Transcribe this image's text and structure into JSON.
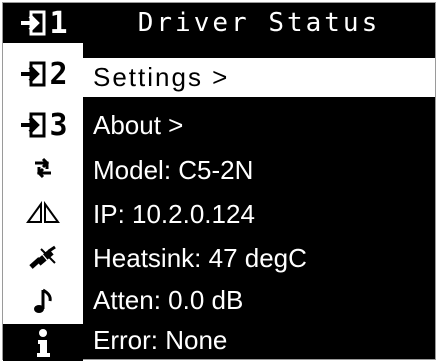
{
  "screen": {
    "title": "Driver Status"
  },
  "sidebar": {
    "items": [
      {
        "icon": "input-icon",
        "label": "1",
        "active": true
      },
      {
        "icon": "input-icon",
        "label": "2",
        "active": false
      },
      {
        "icon": "input-icon",
        "label": "3",
        "active": false
      },
      {
        "icon": "loop-arrows-icon",
        "label": "",
        "active": false
      },
      {
        "icon": "stereo-triangles-icon",
        "label": "",
        "active": false
      },
      {
        "icon": "disconnected-plug-icon",
        "label": "",
        "active": false
      },
      {
        "icon": "music-note-icon",
        "label": "",
        "active": false
      },
      {
        "icon": "info-icon",
        "label": "",
        "active": true
      }
    ]
  },
  "menu": {
    "settings": "Settings >",
    "about": "About >"
  },
  "status": {
    "model": "Model: C5-2N",
    "ip": "IP: 10.2.0.124",
    "heatsink": "Heatsink: 47 degC",
    "atten": "Atten: 0.0 dB",
    "error": "Error: None"
  },
  "colors": {
    "background": "#000000",
    "foreground": "#ffffff",
    "border": "#9a9a9a"
  }
}
